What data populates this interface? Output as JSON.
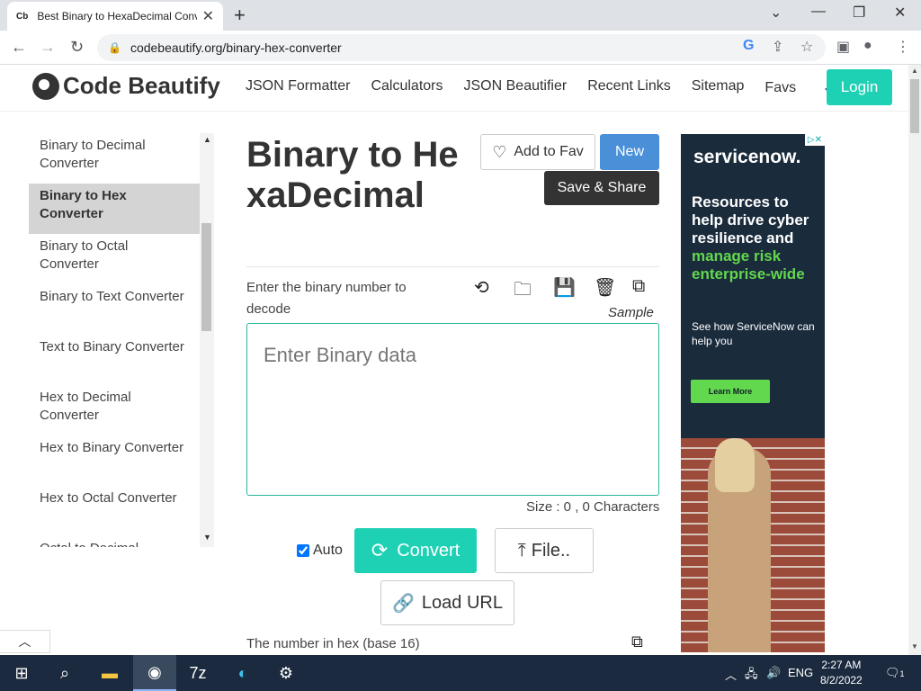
{
  "browser": {
    "tab_favicon": "Cb",
    "tab_title": "Best Binary to HexaDecimal Conv",
    "tab_close": "✕",
    "new_tab": "+",
    "url": "codebeautify.org/binary-hex-converter",
    "window_controls": [
      "⌄",
      "—",
      "❐",
      "✕"
    ]
  },
  "site": {
    "logo_text": "Code Beautify",
    "nav": [
      "JSON Formatter",
      "Calculators",
      "JSON Beautifier",
      "Recent Links",
      "Sitemap",
      "Favs"
    ],
    "login": "Login"
  },
  "sidebar": {
    "items": [
      "Binary to Decimal Converter",
      "Binary to Hex Converter",
      "Binary to Octal Converter",
      "Binary to Text Converter",
      "Text to Binary Converter",
      "Hex to Decimal Converter",
      "Hex to Binary Converter",
      "Hex to Octal Converter",
      "Octal to Decimal Converter"
    ],
    "active_index": 1
  },
  "main": {
    "title": "Binary to HexaDecimal",
    "add_fav": "Add to Fav",
    "new": "New",
    "save_share": "Save & Share",
    "input_label": "Enter the binary number to decode",
    "sample": "Sample",
    "input_placeholder": "Enter Binary data",
    "input_value": "",
    "size_text": "Size : 0 , 0 Characters",
    "auto_label": "Auto",
    "auto_checked": true,
    "convert": "Convert",
    "file": "File..",
    "load_url": "Load URL",
    "output_label": "The number in hex (base 16)"
  },
  "ad": {
    "brand": "servicenow.",
    "headline": "Resources to help drive cyber resilience and",
    "headline_accent": "manage risk enterprise-wide",
    "subtext": "See how ServiceNow can help you",
    "cta": "Learn More"
  },
  "taskbar": {
    "language": "ENG",
    "time": "2:27 AM",
    "date": "8/2/2022",
    "notifications": "1"
  },
  "colors": {
    "accent": "#1fd1b4",
    "new_button": "#4a90d9",
    "dark_button": "#333333",
    "ad_background": "#1a2b3c",
    "ad_green": "#62d84e"
  }
}
